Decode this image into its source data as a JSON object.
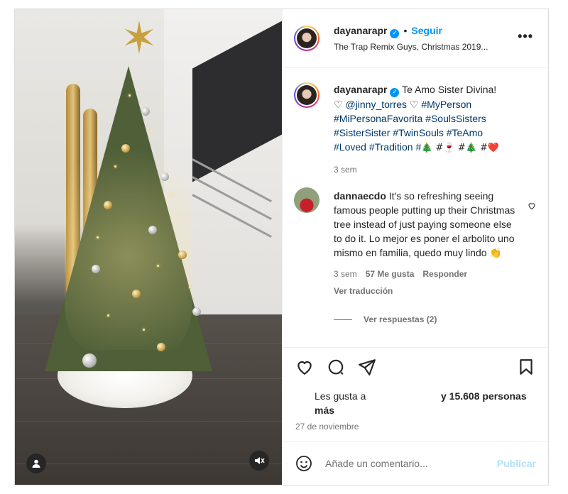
{
  "post": {
    "author": {
      "username": "dayanarapr",
      "verified_icon": "verified-badge-icon",
      "follow_label": "Seguir",
      "separator": "•",
      "audio_subtitle": "The Trap Remix Guys, Christmas 2019..."
    },
    "more_label": "•••",
    "caption": {
      "username": "dayanarapr",
      "text_1": "Te Amo Sister Divina!",
      "heart_1": "♡",
      "mention": "@jinny_torres",
      "heart_2": "♡",
      "hashtags_1": "#MyPerson",
      "hashtags_2": "#MiPersonaFavorita #SoulsSisters",
      "hashtags_3": "#SisterSister #TwinSouls #TeAmo",
      "hashtags_4": "#Loved #Tradition #",
      "emoji_line": "🎄 #🍷 #🎄 #❤️",
      "time": "3 sem"
    },
    "comment": {
      "username": "dannaecdo",
      "text": "It's so refreshing seeing famous people putting up their Christmas tree instead of just paying someone else to do it. Lo mejor es poner el arbolito uno mismo en familia, quedo muy lindo 👏",
      "time": "3 sem",
      "likes": "57 Me gusta",
      "reply": "Responder",
      "translate": "Ver traducción",
      "view_replies": "Ver respuestas (2)"
    },
    "likes_text_left": "Les gusta a",
    "likes_text_right": "y 15.608 personas",
    "likes_text_more": "más",
    "date": "27 de noviembre",
    "composer": {
      "placeholder": "Añade un comentario...",
      "publish": "Publicar"
    }
  },
  "colors": {
    "accent": "#0095f6",
    "text": "#262626",
    "muted": "#737373",
    "link": "#00376b",
    "publish_disabled": "#b2dffc"
  }
}
